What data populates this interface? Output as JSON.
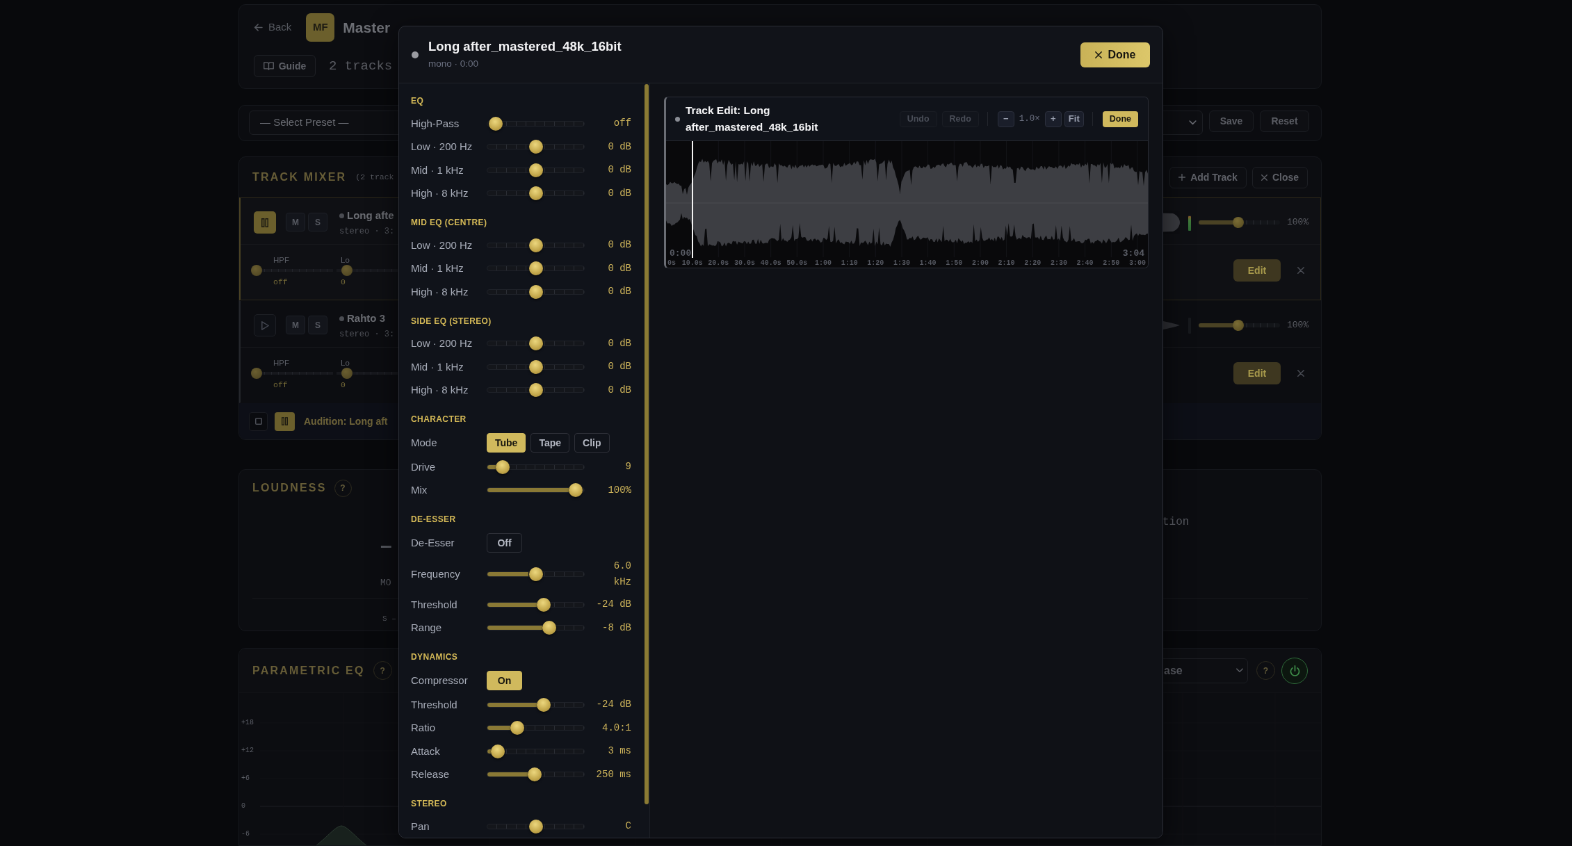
{
  "header": {
    "back": "Back",
    "logo": "MF",
    "title": "Master",
    "guide": "Guide",
    "track_count": "2 tracks"
  },
  "presets": {
    "select": "— Select Preset —",
    "buttons": [
      {
        "kind": "save",
        "label": "Save"
      },
      {
        "kind": "reset",
        "label": "Reset"
      }
    ]
  },
  "track_mixer": {
    "title": "TRACK MIXER",
    "count": "(2 track",
    "buttons": [
      {
        "kind": "add",
        "label": "Add Track"
      },
      {
        "kind": "close",
        "label": "Close"
      }
    ],
    "tracks": [
      {
        "selected": true,
        "playing": true,
        "mute": "M",
        "solo": "S",
        "name": "Long afte",
        "meta": "stereo · 3:",
        "controls": [
          {
            "label": "HPF",
            "value": "off",
            "level": 0
          },
          {
            "label": "Lo",
            "value": "0",
            "level": 0.1
          }
        ],
        "meter": {
          "level": 0.9
        },
        "volume": {
          "level": 0.49,
          "reading": "100%"
        },
        "edit": "Edit"
      },
      {
        "selected": false,
        "playing": false,
        "mute": "M",
        "solo": "S",
        "name": "Rahto 3",
        "meta": "stereo · 3:",
        "controls": [
          {
            "label": "HPF",
            "value": "off",
            "level": 0
          },
          {
            "label": "Lo",
            "value": "0",
            "level": 0.1
          }
        ],
        "meter": {
          "level": 0
        },
        "volume": {
          "level": 0.49,
          "reading": "100%"
        },
        "edit": "Edit"
      }
    ],
    "audition": {
      "playing": true,
      "text": "Audition: Long aft"
    }
  },
  "loudness": {
    "title": "LOUDNESS",
    "help": "?",
    "reading": "–",
    "rows": [
      "MO",
      "S –"
    ],
    "side_label": "tion"
  },
  "parametric_eq": {
    "title": "PARAMETRIC EQ",
    "help": "?",
    "preset": "ase",
    "help_right": "?",
    "power": {
      "on": true
    },
    "y_labels": [
      "+18",
      "+12",
      "+6",
      "0",
      "-6"
    ]
  },
  "editor": {
    "title": "Long after_mastered_48k_16bit",
    "subtitle": "mono · 0:00",
    "done": "Done",
    "sections": [
      {
        "title": "EQ",
        "rows": [
          {
            "kind": "slider",
            "label": "High-Pass",
            "level": 0,
            "centered": false,
            "reading": "off"
          },
          {
            "kind": "slider",
            "label": "Low · 200 Hz",
            "level": 0.5,
            "centered": true,
            "reading": "0 dB"
          },
          {
            "kind": "slider",
            "label": "Mid · 1 kHz",
            "level": 0.5,
            "centered": true,
            "reading": "0 dB"
          },
          {
            "kind": "slider",
            "label": "High · 8 kHz",
            "level": 0.5,
            "centered": true,
            "reading": "0 dB"
          }
        ]
      },
      {
        "title": "MID EQ (CENTRE)",
        "rows": [
          {
            "kind": "slider",
            "label": "Low · 200 Hz",
            "level": 0.5,
            "centered": true,
            "reading": "0 dB"
          },
          {
            "kind": "slider",
            "label": "Mid · 1 kHz",
            "level": 0.5,
            "centered": true,
            "reading": "0 dB"
          },
          {
            "kind": "slider",
            "label": "High · 8 kHz",
            "level": 0.5,
            "centered": true,
            "reading": "0 dB"
          }
        ]
      },
      {
        "title": "SIDE EQ (STEREO)",
        "rows": [
          {
            "kind": "slider",
            "label": "Low · 200 Hz",
            "level": 0.5,
            "centered": true,
            "reading": "0 dB"
          },
          {
            "kind": "slider",
            "label": "Mid · 1 kHz",
            "level": 0.5,
            "centered": true,
            "reading": "0 dB"
          },
          {
            "kind": "slider",
            "label": "High · 8 kHz",
            "level": 0.5,
            "centered": true,
            "reading": "0 dB"
          }
        ]
      },
      {
        "title": "CHARACTER",
        "rows": [
          {
            "kind": "segmented",
            "label": "Mode",
            "options": [
              {
                "label": "Tube",
                "selected": true
              },
              {
                "label": "Tape",
                "selected": false
              },
              {
                "label": "Clip",
                "selected": false
              }
            ]
          },
          {
            "kind": "slider",
            "label": "Drive",
            "level": 0.09,
            "centered": false,
            "reading": "9"
          },
          {
            "kind": "slider",
            "label": "Mix",
            "level": 1,
            "centered": false,
            "reading": "100%"
          }
        ]
      },
      {
        "title": "DE-ESSER",
        "rows": [
          {
            "kind": "toggle",
            "label": "De-Esser",
            "on": false,
            "text": "Off"
          },
          {
            "kind": "slider",
            "label": "Frequency",
            "level": 0.5,
            "centered": false,
            "reading": "6.0 kHz"
          },
          {
            "kind": "slider",
            "label": "Threshold",
            "level": 0.6,
            "centered": false,
            "reading": "-24 dB"
          },
          {
            "kind": "slider",
            "label": "Range",
            "level": 0.667,
            "centered": false,
            "reading": "-8 dB"
          }
        ]
      },
      {
        "title": "DYNAMICS",
        "rows": [
          {
            "kind": "toggle",
            "label": "Compressor",
            "on": true,
            "text": "On"
          },
          {
            "kind": "slider",
            "label": "Threshold",
            "level": 0.6,
            "centered": false,
            "reading": "-24 dB"
          },
          {
            "kind": "slider",
            "label": "Ratio",
            "level": 0.27,
            "centered": false,
            "reading": "4.0:1"
          },
          {
            "kind": "slider",
            "label": "Attack",
            "level": 0.03,
            "centered": false,
            "reading": "3 ms"
          },
          {
            "kind": "slider",
            "label": "Release",
            "level": 0.485,
            "centered": false,
            "reading": "250 ms"
          }
        ]
      },
      {
        "title": "STEREO",
        "rows": [
          {
            "kind": "slider",
            "label": "Pan",
            "level": 0.5,
            "centered": true,
            "reading": "C"
          }
        ]
      }
    ],
    "track_edit": {
      "title": "Track Edit: Long after_mastered_48k_16bit",
      "history": [
        {
          "label": "Undo",
          "disabled": true
        },
        {
          "label": "Redo",
          "disabled": true
        }
      ],
      "zoom": [
        {
          "kind": "zoom-out",
          "label": "−"
        },
        {
          "kind": "readout",
          "label": "1.0×"
        },
        {
          "kind": "zoom-in",
          "label": "+"
        },
        {
          "kind": "fit",
          "label": "Fit"
        }
      ],
      "done": "Done",
      "playhead": {
        "level": 0.055
      },
      "start": "0:00",
      "end": "3:04",
      "ticks": [
        "0s",
        "10.0s",
        "20.0s",
        "30.0s",
        "40.0s",
        "50.0s",
        "1:00",
        "1:10",
        "1:20",
        "1:30",
        "1:40",
        "1:50",
        "2:00",
        "2:10",
        "2:20",
        "2:30",
        "2:40",
        "2:50",
        "3:00"
      ]
    }
  }
}
